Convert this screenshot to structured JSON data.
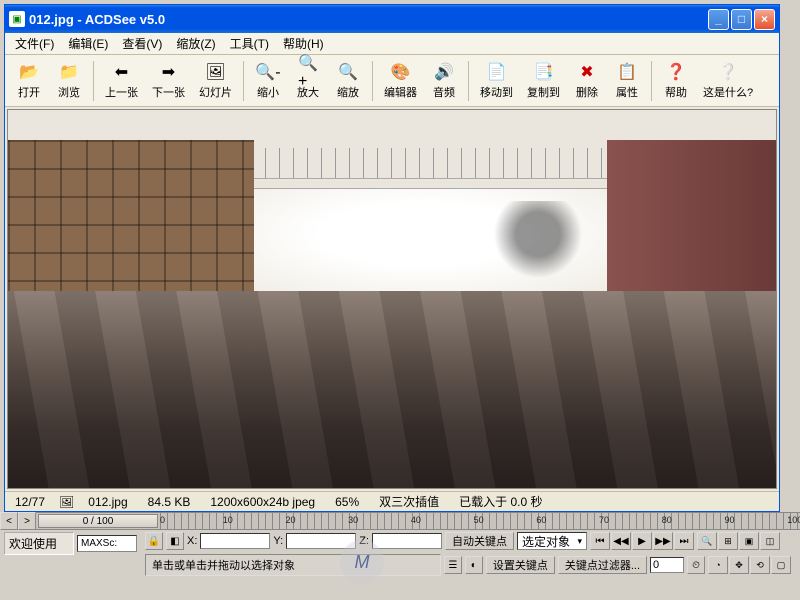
{
  "window": {
    "title": "012.jpg - ACDSee v5.0",
    "icon_glyph": "▣"
  },
  "menu": {
    "file": "文件(F)",
    "edit": "编辑(E)",
    "view": "查看(V)",
    "zoom": "缩放(Z)",
    "tools": "工具(T)",
    "help": "帮助(H)"
  },
  "toolbar": {
    "open": "打开",
    "browse": "浏览",
    "prev": "上一张",
    "next": "下一张",
    "slideshow": "幻灯片",
    "zoomout": "缩小",
    "zoomin": "放大",
    "zoom": "缩放",
    "editor": "编辑器",
    "audio": "音频",
    "moveto": "移动到",
    "copyto": "复制到",
    "delete": "删除",
    "properties": "属性",
    "help": "帮助",
    "whatsthis": "这是什么?"
  },
  "icons": {
    "open": "📂",
    "browse": "📁",
    "prev": "⬅",
    "next": "➡",
    "slideshow": "🖼",
    "zoomout": "🔍-",
    "zoomin": "🔍+",
    "zoom": "🔍",
    "editor": "🎨",
    "audio": "🔊",
    "moveto": "📄",
    "copyto": "📑",
    "delete": "✖",
    "properties": "📋",
    "help": "❓",
    "whatsthis": "❔"
  },
  "status": {
    "index": "12/77",
    "filename": "012.jpg",
    "size": "84.5 KB",
    "dims": "1200x600x24b jpeg",
    "zoom": "65%",
    "interp": "双三次插值",
    "loadtime": "已载入于 0.0 秒"
  },
  "max": {
    "welcome": "欢迎使用",
    "script_label": "MAXSc:",
    "slider": "0 / 100",
    "ticks": [
      "0",
      "10",
      "20",
      "30",
      "40",
      "50",
      "60",
      "70",
      "80",
      "90",
      "100"
    ],
    "x": "X:",
    "y": "Y:",
    "z": "Z:",
    "hint": "单击或单击并拖动以选择对象",
    "autokey": "自动关键点",
    "setkey": "设置关键点",
    "selected": "选定对象",
    "keyfilter": "关键点过滤器...",
    "frame": "0"
  }
}
